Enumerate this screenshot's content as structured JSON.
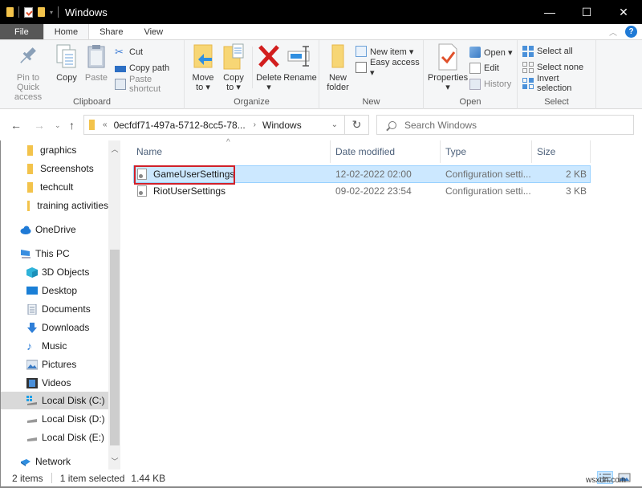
{
  "window": {
    "title": "Windows",
    "controls": {
      "minimize": "—",
      "maximize": "☐",
      "close": "✕"
    }
  },
  "ribbon_tabs": [
    "File",
    "Home",
    "Share",
    "View"
  ],
  "ribbon": {
    "clipboard": {
      "label": "Clipboard",
      "pin": "Pin to Quick access",
      "pin_line1": "Pin to Quick",
      "pin_line2": "access",
      "copy": "Copy",
      "paste": "Paste",
      "cut": "Cut",
      "copy_path": "Copy path",
      "paste_shortcut": "Paste shortcut"
    },
    "organize": {
      "label": "Organize",
      "move_to_line1": "Move",
      "move_to_line2": "to ▾",
      "copy_to_line1": "Copy",
      "copy_to_line2": "to ▾",
      "delete": "Delete",
      "delete_caret": "▾",
      "rename": "Rename"
    },
    "new": {
      "label": "New",
      "new_folder_line1": "New",
      "new_folder_line2": "folder",
      "new_item": "New item ▾",
      "easy_access": "Easy access ▾"
    },
    "open": {
      "label": "Open",
      "properties": "Properties",
      "properties_caret": "▾",
      "open": "Open ▾",
      "edit": "Edit",
      "history": "History"
    },
    "select": {
      "label": "Select",
      "select_all": "Select all",
      "select_none": "Select none",
      "invert_selection": "Invert selection"
    }
  },
  "address": {
    "overflow": "«",
    "segments": [
      "0ecfdf71-497a-5712-8cc5-78...",
      "Windows"
    ],
    "separator": "›",
    "search_placeholder": "Search Windows"
  },
  "nav_pane": {
    "items": [
      {
        "label": "graphics",
        "icon": "folder-icon",
        "indent": 2
      },
      {
        "label": "Screenshots",
        "icon": "folder-icon",
        "indent": 2
      },
      {
        "label": "techcult",
        "icon": "folder-icon",
        "indent": 2
      },
      {
        "label": "training activities",
        "icon": "folder-icon",
        "indent": 2
      },
      {
        "label": "OneDrive",
        "icon": "cloud-icon",
        "indent": 1
      },
      {
        "label": "This PC",
        "icon": "computer-icon",
        "indent": 1
      },
      {
        "label": "3D Objects",
        "icon": "cube-icon",
        "indent": 2
      },
      {
        "label": "Desktop",
        "icon": "desktop-icon",
        "indent": 2
      },
      {
        "label": "Documents",
        "icon": "document-icon",
        "indent": 2
      },
      {
        "label": "Downloads",
        "icon": "download-arrow-icon",
        "indent": 2
      },
      {
        "label": "Music",
        "icon": "music-note-icon",
        "indent": 2
      },
      {
        "label": "Pictures",
        "icon": "pictures-icon",
        "indent": 2
      },
      {
        "label": "Videos",
        "icon": "film-icon",
        "indent": 2
      },
      {
        "label": "Local Disk (C:)",
        "icon": "windows-drive-icon",
        "indent": 2,
        "selected": true
      },
      {
        "label": "Local Disk (D:)",
        "icon": "drive-icon",
        "indent": 2
      },
      {
        "label": "Local Disk (E:)",
        "icon": "drive-icon",
        "indent": 2
      },
      {
        "label": "Network",
        "icon": "network-icon",
        "indent": 1
      }
    ]
  },
  "file_list": {
    "columns": [
      "Name",
      "Date modified",
      "Type",
      "Size"
    ],
    "sort_indicator": "^",
    "rows": [
      {
        "name": "GameUserSettings",
        "date": "12-02-2022 02:00",
        "type": "Configuration setti...",
        "size": "2 KB",
        "selected": true,
        "highlighted": true
      },
      {
        "name": "RiotUserSettings",
        "date": "09-02-2022 23:54",
        "type": "Configuration setti...",
        "size": "3 KB",
        "selected": false
      }
    ]
  },
  "status_bar": {
    "item_count": "2 items",
    "selection": "1 item selected",
    "size": "1.44 KB"
  },
  "watermark": "wsxdn.com",
  "colors": {
    "accent": "#1f7ad6",
    "selection_bg": "#cce8ff",
    "selection_border": "#99d1ff",
    "highlight_box": "#d0202a",
    "folder": "#f3c34b"
  }
}
